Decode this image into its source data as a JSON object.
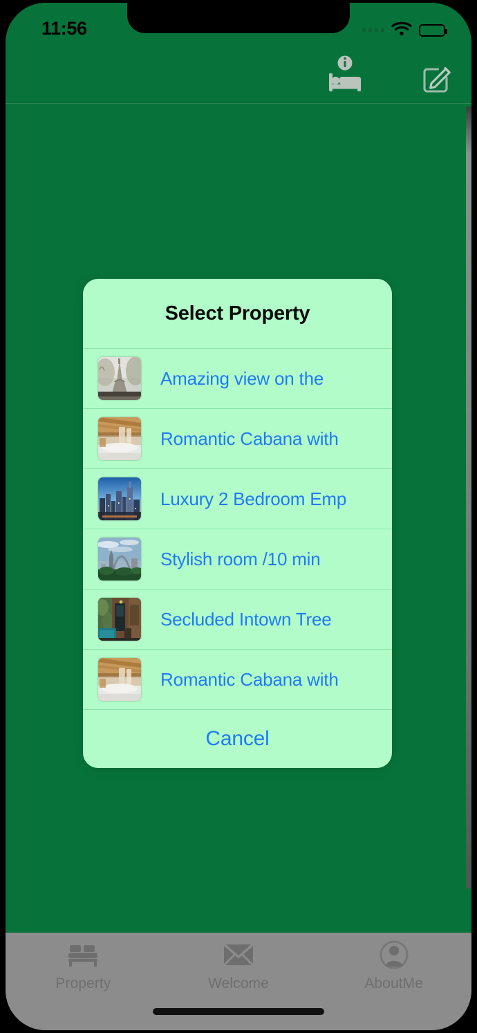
{
  "status_bar": {
    "time": "11:56",
    "signal_icon": "signal-dots-icon",
    "wifi_icon": "wifi-icon",
    "battery_icon": "battery-full-icon"
  },
  "nav_bar": {
    "bed_info_button": {
      "icon": "bed-info-icon",
      "label": ""
    },
    "compose_button": {
      "icon": "compose-square-pencil-icon",
      "label": ""
    }
  },
  "modal": {
    "title": "Select Property",
    "items": [
      {
        "label": "Amazing view on the",
        "thumb": "eiffel-tower-thumbnail"
      },
      {
        "label": "Romantic Cabana with",
        "thumb": "wooden-cabana-bedroom-thumbnail"
      },
      {
        "label": "Luxury 2 Bedroom Emp",
        "thumb": "city-skyline-thumbnail"
      },
      {
        "label": "Stylish room /10 min",
        "thumb": "gateway-arch-thumbnail"
      },
      {
        "label": "Secluded Intown Tree",
        "thumb": "treehouse-porch-thumbnail"
      },
      {
        "label": "Romantic Cabana with",
        "thumb": "wooden-cabana-bedroom-thumbnail"
      }
    ],
    "cancel_label": "Cancel"
  },
  "tab_bar": {
    "tabs": [
      {
        "label": "Property",
        "icon": "bed-icon"
      },
      {
        "label": "Welcome",
        "icon": "envelope-icon"
      },
      {
        "label": "AboutMe",
        "icon": "person-circle-icon"
      }
    ]
  },
  "colors": {
    "app_green": "#07733a",
    "modal_mint": "#b2fcc9",
    "link_blue": "#1f7bf4",
    "tab_bar_gray": "#8c8c8c",
    "tab_label_gray": "#6e6e6e",
    "divider_green": "#86e5a6"
  }
}
